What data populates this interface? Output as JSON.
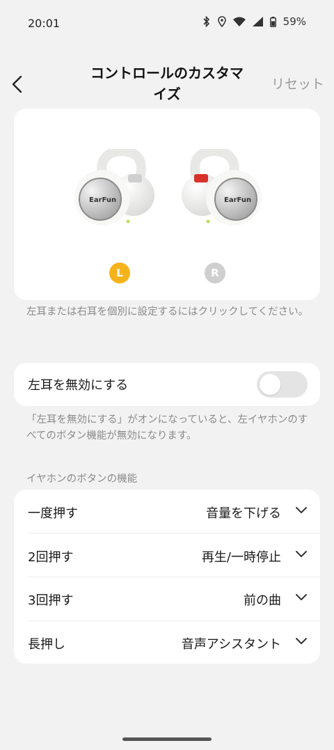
{
  "status": {
    "time": "20:01",
    "battery": "59%"
  },
  "header": {
    "title_line1": "コントロールのカスタマ",
    "title_line2": "イズ",
    "reset": "リセット"
  },
  "earbuds": {
    "left_badge": "L",
    "right_badge": "R",
    "left_brand": "EarFun",
    "right_brand": "EarFun",
    "selected": "L",
    "accent_selected": "#f5b31b"
  },
  "hint_select": "左耳または右耳を個別に設定するにはクリックしてください。",
  "disable": {
    "label": "左耳を無効にする",
    "enabled": false,
    "description": "「左耳を無効にする」がオンになっていると、左イヤホンのすべてのボタン機能が無効になります。"
  },
  "functions": {
    "section_title": "イヤホンのボタンの機能",
    "rows": [
      {
        "label": "一度押す",
        "value": "音量を下げる"
      },
      {
        "label": "2回押す",
        "value": "再生/一時停止"
      },
      {
        "label": "3回押す",
        "value": "前の曲"
      },
      {
        "label": "長押し",
        "value": "音声アシスタント"
      }
    ]
  }
}
